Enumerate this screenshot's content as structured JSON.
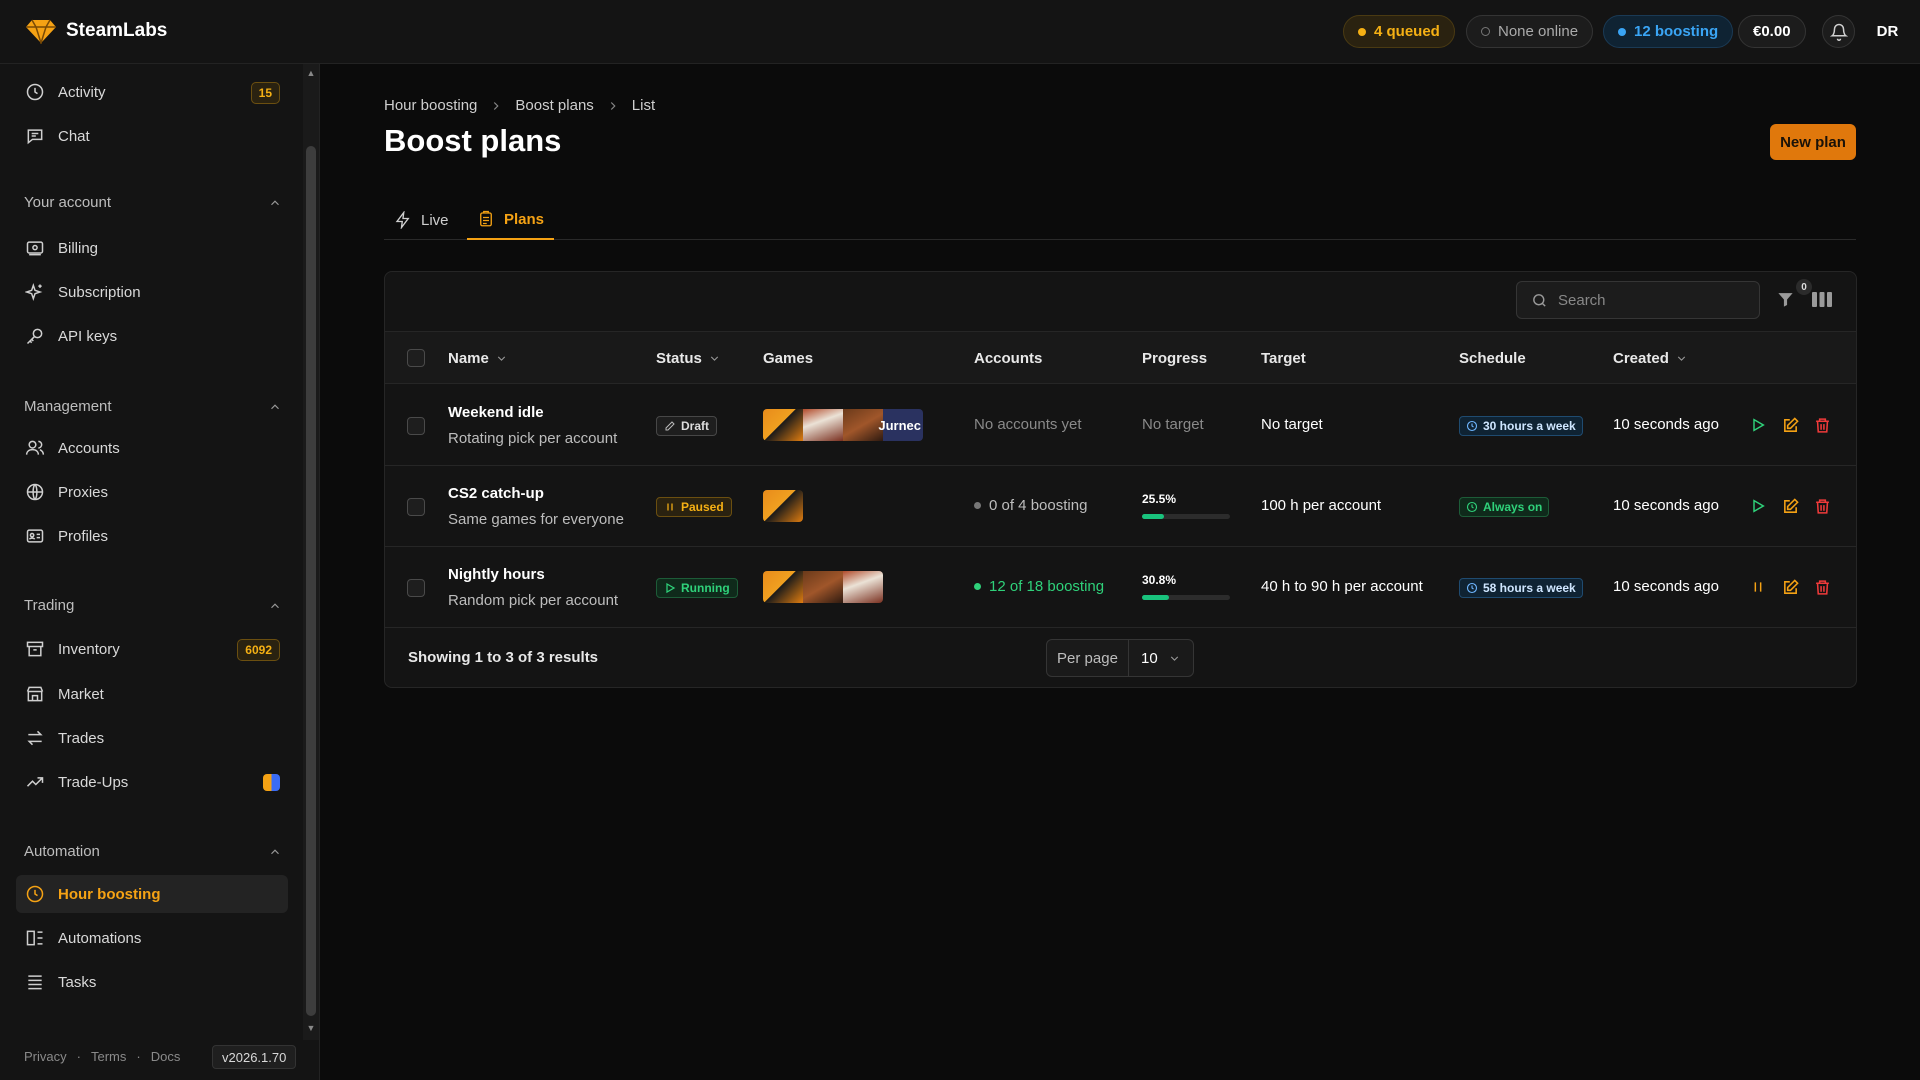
{
  "app": {
    "name": "SteamLabs"
  },
  "header": {
    "queued": "4 queued",
    "online": "None online",
    "boosting": "12 boosting",
    "balance": "€0.00",
    "avatar": "DR"
  },
  "sidebar": {
    "top_items": [
      {
        "label": "Activity",
        "badge": "15",
        "icon": "clock-icon"
      },
      {
        "label": "Chat",
        "icon": "chat-icon"
      }
    ],
    "sections": [
      {
        "title": "Your account",
        "items": [
          {
            "label": "Billing",
            "icon": "billing-icon"
          },
          {
            "label": "Subscription",
            "icon": "sparkle-icon"
          },
          {
            "label": "API keys",
            "icon": "key-icon"
          }
        ]
      },
      {
        "title": "Management",
        "items": [
          {
            "label": "Accounts",
            "icon": "users-icon"
          },
          {
            "label": "Proxies",
            "icon": "globe-icon"
          },
          {
            "label": "Profiles",
            "icon": "id-card-icon"
          }
        ]
      },
      {
        "title": "Trading",
        "items": [
          {
            "label": "Inventory",
            "badge": "6092",
            "icon": "archive-icon"
          },
          {
            "label": "Market",
            "icon": "store-icon"
          },
          {
            "label": "Trades",
            "icon": "arrows-swap-icon"
          },
          {
            "label": "Trade-Ups",
            "icon": "trend-up-icon"
          }
        ]
      },
      {
        "title": "Automation",
        "items": [
          {
            "label": "Hour boosting",
            "icon": "clock-icon",
            "active": true
          },
          {
            "label": "Automations",
            "icon": "blocks-icon"
          },
          {
            "label": "Tasks",
            "icon": "list-icon"
          }
        ]
      }
    ],
    "footer": {
      "privacy": "Privacy",
      "terms": "Terms",
      "docs": "Docs",
      "version": "v2026.1.70",
      "sep": "·"
    }
  },
  "breadcrumb": [
    "Hour boosting",
    "Boost plans",
    "List"
  ],
  "page": {
    "title": "Boost plans",
    "new_button": "New plan"
  },
  "tabs": [
    {
      "label": "Live"
    },
    {
      "label": "Plans",
      "active": true
    }
  ],
  "toolbar": {
    "search_placeholder": "Search",
    "filter_count": "0"
  },
  "table": {
    "columns": [
      "Name",
      "Status",
      "Games",
      "Accounts",
      "Progress",
      "Target",
      "Schedule",
      "Created"
    ],
    "rows": [
      {
        "name": "Weekend idle",
        "sub": "Rotating pick per account",
        "status": "Draft",
        "games": [
          "cs2",
          "rust",
          "dayz",
          "unturned"
        ],
        "games_text": "Jurnec",
        "accounts": "No accounts yet",
        "progress": "No target",
        "target": "No target",
        "schedule": "30 hours a week",
        "created": "10 seconds ago",
        "action": "play"
      },
      {
        "name": "CS2 catch-up",
        "sub": "Same games for everyone",
        "status": "Paused",
        "games": [
          "cs2"
        ],
        "accounts": "0 of 4 boosting",
        "progress": "25.5%",
        "progress_value": 25.5,
        "target": "100 h per account",
        "schedule": "Always on",
        "created": "10 seconds ago",
        "action": "play"
      },
      {
        "name": "Nightly hours",
        "sub": "Random pick per account",
        "status": "Running",
        "games": [
          "cs2",
          "dayz",
          "rust"
        ],
        "accounts": "12 of 18 boosting",
        "progress": "30.8%",
        "progress_value": 30.8,
        "target": "40 h to 90 h per account",
        "schedule": "58 hours a week",
        "created": "10 seconds ago",
        "action": "pause"
      }
    ]
  },
  "footer": {
    "showing": "Showing 1 to 3 of 3 results",
    "per_page_label": "Per page",
    "per_page_value": "10"
  }
}
